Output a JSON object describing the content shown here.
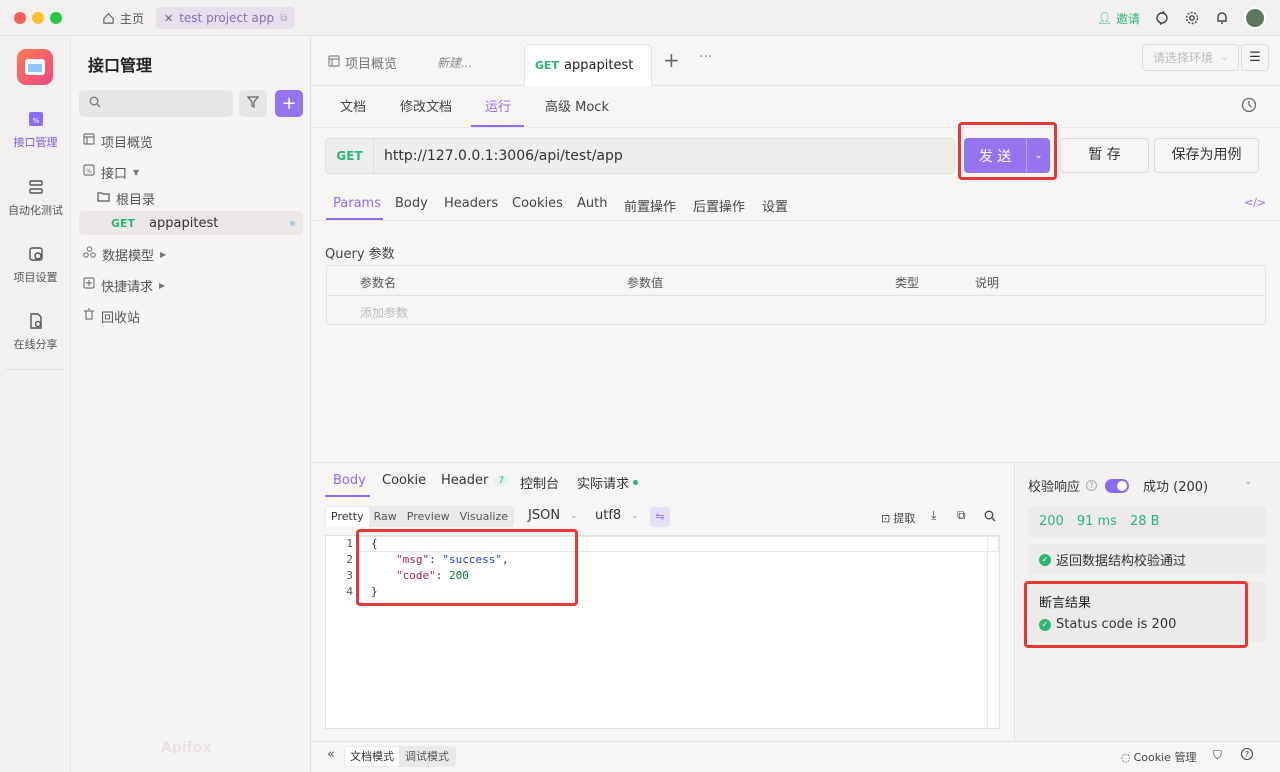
{
  "titlebar": {
    "home_label": "主页",
    "project_tab_label": "test project app",
    "invite_label": "邀请"
  },
  "rail": {
    "items": [
      {
        "label": "接口管理",
        "icon": "api-icon"
      },
      {
        "label": "自动化测试",
        "icon": "automation-icon"
      },
      {
        "label": "项目设置",
        "icon": "settings-icon"
      },
      {
        "label": "在线分享",
        "icon": "share-icon"
      }
    ]
  },
  "tree": {
    "title": "接口管理",
    "items": {
      "overview": "项目概览",
      "interfaces": "接口",
      "root": "根目录",
      "api_method": "GET",
      "api_name": "appapitest",
      "data_models": "数据模型",
      "quick_requests": "快捷请求",
      "trash": "回收站"
    },
    "watermark": "Apifox"
  },
  "main": {
    "tabs": {
      "overview": "项目概览",
      "new": "新建...",
      "active_method": "GET",
      "active_name": "appapitest"
    },
    "env_placeholder": "请选择环境",
    "subtabs": [
      "文档",
      "修改文档",
      "运行",
      "高级 Mock"
    ],
    "request": {
      "method": "GET",
      "url": "http://127.0.0.1:3006/api/test/app",
      "send_label": "发 送",
      "save_label": "暂 存",
      "save_case_label": "保存为用例"
    },
    "param_tabs": [
      "Params",
      "Body",
      "Headers",
      "Cookies",
      "Auth",
      "前置操作",
      "后置操作",
      "设置"
    ],
    "query_title": "Query 参数",
    "query_columns": [
      "参数名",
      "参数值",
      "类型",
      "说明"
    ],
    "query_add_placeholder": "添加参数",
    "response_tabs": {
      "body": "Body",
      "cookie": "Cookie",
      "header": "Header",
      "header_count": "7",
      "console": "控制台",
      "actual": "实际请求"
    },
    "view_modes": [
      "Pretty",
      "Raw",
      "Preview",
      "Visualize"
    ],
    "format": "JSON",
    "encoding": "utf8",
    "extract_label": "提取",
    "code_lines": [
      {
        "n": "1",
        "text": "{"
      },
      {
        "n": "2",
        "key": "\"msg\"",
        "val": "\"success\"",
        "tail": ","
      },
      {
        "n": "3",
        "key": "\"code\"",
        "num": "200",
        "tail": ""
      },
      {
        "n": "4",
        "text": "}"
      }
    ],
    "validate": {
      "label": "校验响应",
      "result": "成功 (200)",
      "status": "200",
      "time": "91 ms",
      "size": "28 B",
      "schema_pass": "返回数据结构校验通过",
      "assert_title": "断言结果",
      "assert_item": "Status code is 200"
    },
    "footer": {
      "doc_mode": "文档模式",
      "debug_mode": "调试模式",
      "cookie_manage": "Cookie 管理"
    }
  },
  "colors": {
    "accent": "#8b6cf0",
    "get": "#2bb673",
    "highlight": "#e53935"
  }
}
